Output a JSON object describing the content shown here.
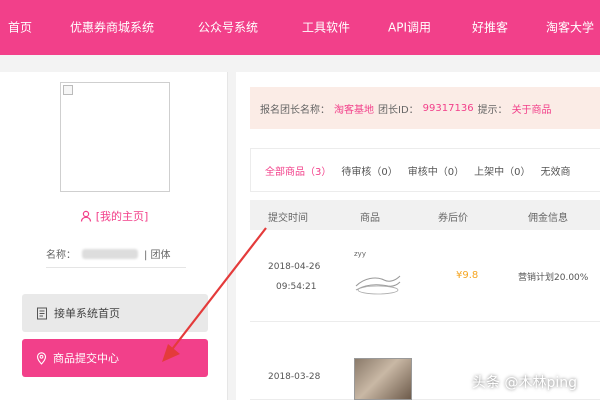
{
  "topnav": {
    "items": [
      "首页",
      "优惠券商城系统",
      "公众号系统",
      "工具软件",
      "API调用",
      "好推客",
      "淘客大学"
    ]
  },
  "sidebar": {
    "home_link": "[我的主页]",
    "name_label": "名称：",
    "name_suffix": "| 团体",
    "buttons": [
      "接单系统首页",
      "商品提交中心"
    ]
  },
  "notice": {
    "part1": "报名团长名称：",
    "leader_name": "淘客基地",
    "part2": "团长ID：",
    "leader_id": "99317136",
    "part3": "提示：",
    "tip": "关于商品"
  },
  "tabs": [
    "全部商品（3）",
    "待审核（0）",
    "审核中（0）",
    "上架中（0）",
    "无效商"
  ],
  "table": {
    "headers": [
      "提交时间",
      "商品",
      "券后价",
      "佣金信息"
    ],
    "rows": [
      {
        "date": "2018-04-26",
        "time": "09:54:21",
        "product_label": "zyy",
        "price": "¥9.8",
        "commission": "营销计划20.00%"
      },
      {
        "date": "2018-03-28",
        "time": "",
        "product_label": "",
        "price": "",
        "commission": ""
      }
    ]
  },
  "watermark": "头条 @木林ping",
  "colors": {
    "brand": "#f2408a",
    "price": "#f5a623"
  },
  "icons": [
    "user-icon",
    "document-icon",
    "location-pin-icon"
  ]
}
